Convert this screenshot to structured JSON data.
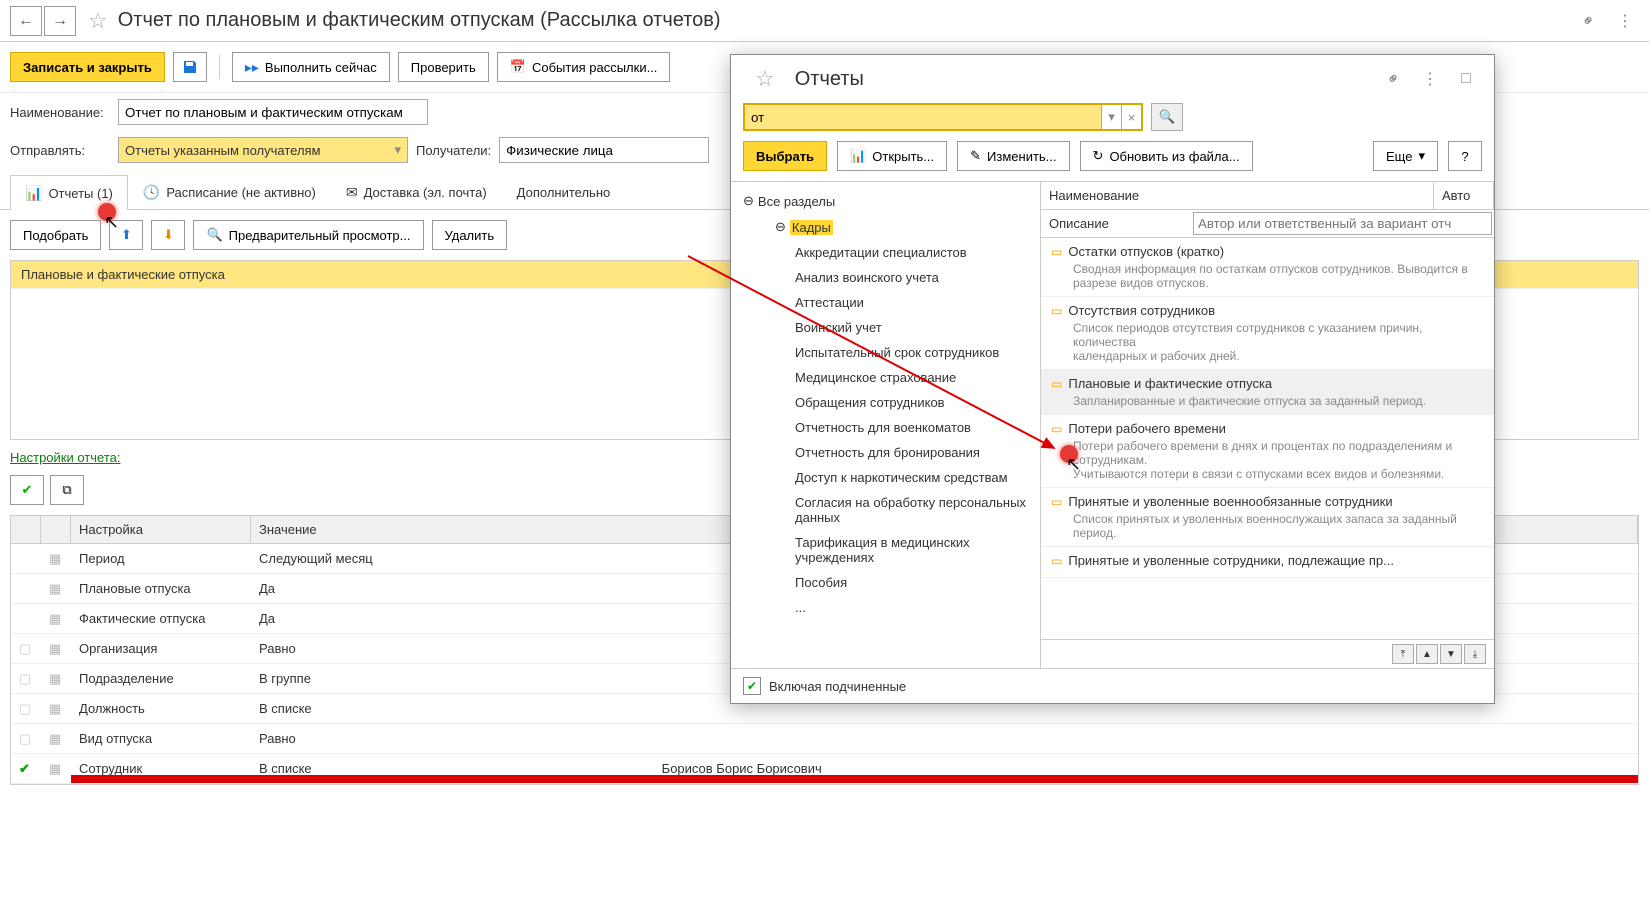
{
  "title": "Отчет по плановым и фактическим отпускам (Рассылка отчетов)",
  "toolbar": {
    "save_close": "Записать и закрыть",
    "run_now": "Выполнить сейчас",
    "check": "Проверить",
    "events": "События рассылки..."
  },
  "form": {
    "name_label": "Наименование:",
    "name_value": "Отчет по плановым и фактическим отпускам",
    "send_label": "Отправлять:",
    "send_value": "Отчеты указанным получателям",
    "recipients_label": "Получатели:",
    "recipients_value": "Физические лица"
  },
  "tabs": {
    "reports": "Отчеты (1)",
    "schedule": "Расписание (не активно)",
    "delivery": "Доставка (эл. почта)",
    "more": "Дополнительно"
  },
  "subtoolbar": {
    "pick": "Подобрать",
    "preview": "Предварительный просмотр...",
    "delete": "Удалить"
  },
  "report_rows": [
    "Плановые и фактические отпуска"
  ],
  "settings_label": "Настройки отчета:",
  "settings_table": {
    "col_name": "Настройка",
    "col_val": "Значение",
    "rows": [
      {
        "check": null,
        "name": "Период",
        "val": "Следующий месяц"
      },
      {
        "check": null,
        "name": "Плановые отпуска",
        "val": "Да"
      },
      {
        "check": null,
        "name": "Фактические отпуска",
        "val": "Да"
      },
      {
        "check": false,
        "name": "Организация",
        "val": "Равно"
      },
      {
        "check": false,
        "name": "Подразделение",
        "val": "В группе"
      },
      {
        "check": false,
        "name": "Должность",
        "val": "В списке"
      },
      {
        "check": false,
        "name": "Вид отпуска",
        "val": "Равно"
      },
      {
        "check": true,
        "name": "Сотрудник",
        "val": "В списке",
        "extra": "Борисов Борис Борисович"
      }
    ]
  },
  "popup": {
    "title": "Отчеты",
    "search_value": "от",
    "select_btn": "Выбрать",
    "open_btn": "Открыть...",
    "edit_btn": "Изменить...",
    "refresh_btn": "Обновить из файла...",
    "more_btn": "Еще",
    "help_btn": "?",
    "tree_root": "Все разделы",
    "tree_highlighted": "Кадры",
    "tree_items": [
      "Аккредитации специалистов",
      "Анализ воинского учета",
      "Аттестации",
      "Воинский учет",
      "Испытательный срок сотрудников",
      "Медицинское страхование",
      "Обращения сотрудников",
      "Отчетность для военкоматов",
      "Отчетность для бронирования",
      "Доступ к наркотическим средствам",
      "Согласия на обработку персональных данных",
      "Тарификация в медицинских учреждениях",
      "Пособия",
      "..."
    ],
    "list_header": {
      "name": "Наименование",
      "author": "Авто"
    },
    "list_desc_label": "Описание",
    "list_filter_placeholder": "Автор или ответственный за вариант отч",
    "list_items": [
      {
        "t": "Остатки отпусков (кратко)",
        "d": "Сводная информация по остаткам отпусков сотрудников. Выводится в разрезе видов отпусков."
      },
      {
        "t": "Отсутствия сотрудников",
        "d": "Список периодов отсутствия сотрудников с указанием причин, количества\nкалендарных и рабочих дней."
      },
      {
        "t": "Плановые и фактические отпуска",
        "d": "Запланированные и фактические отпуска за заданный период.",
        "selected": true
      },
      {
        "t": "Потери рабочего времени",
        "d": "Потери рабочего времени в днях и процентах по подразделениям и сотрудникам.\nУчитываются потери в связи с отпусками всех видов и болезнями."
      },
      {
        "t": "Принятые и уволенные военнообязанные сотрудники",
        "d": "Список принятых и уволенных военнослужащих запаса за заданный период."
      },
      {
        "t": "Принятые и уволенные сотрудники, подлежащие пр...",
        "d": ""
      }
    ],
    "include_sub": "Включая подчиненные"
  }
}
